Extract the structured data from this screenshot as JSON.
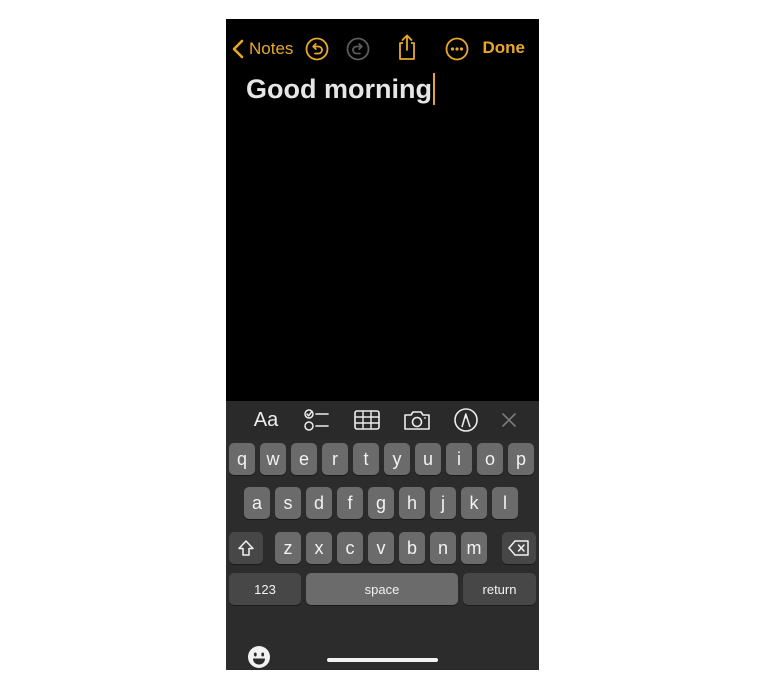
{
  "nav": {
    "back_label": "Notes",
    "done_label": "Done",
    "icons": [
      "chevron-left-icon",
      "undo-icon",
      "redo-icon",
      "share-icon",
      "more-icon"
    ]
  },
  "note": {
    "title": "Good morning"
  },
  "format_bar": {
    "text_style_label": "Aa",
    "icons": [
      "checklist-icon",
      "table-icon",
      "camera-icon",
      "markup-icon",
      "close-icon"
    ]
  },
  "keyboard": {
    "row1": [
      "q",
      "w",
      "e",
      "r",
      "t",
      "y",
      "u",
      "i",
      "o",
      "p"
    ],
    "row2": [
      "a",
      "s",
      "d",
      "f",
      "g",
      "h",
      "j",
      "k",
      "l"
    ],
    "row3": [
      "z",
      "x",
      "c",
      "v",
      "b",
      "n",
      "m"
    ],
    "numbers_label": "123",
    "space_label": "space",
    "return_label": "return",
    "icons": [
      "shift-icon",
      "delete-icon",
      "emoji-icon"
    ]
  },
  "colors": {
    "accent": "#e9a82b",
    "background": "#000000",
    "key": "#6b6b6b",
    "key_dark": "#474747"
  }
}
